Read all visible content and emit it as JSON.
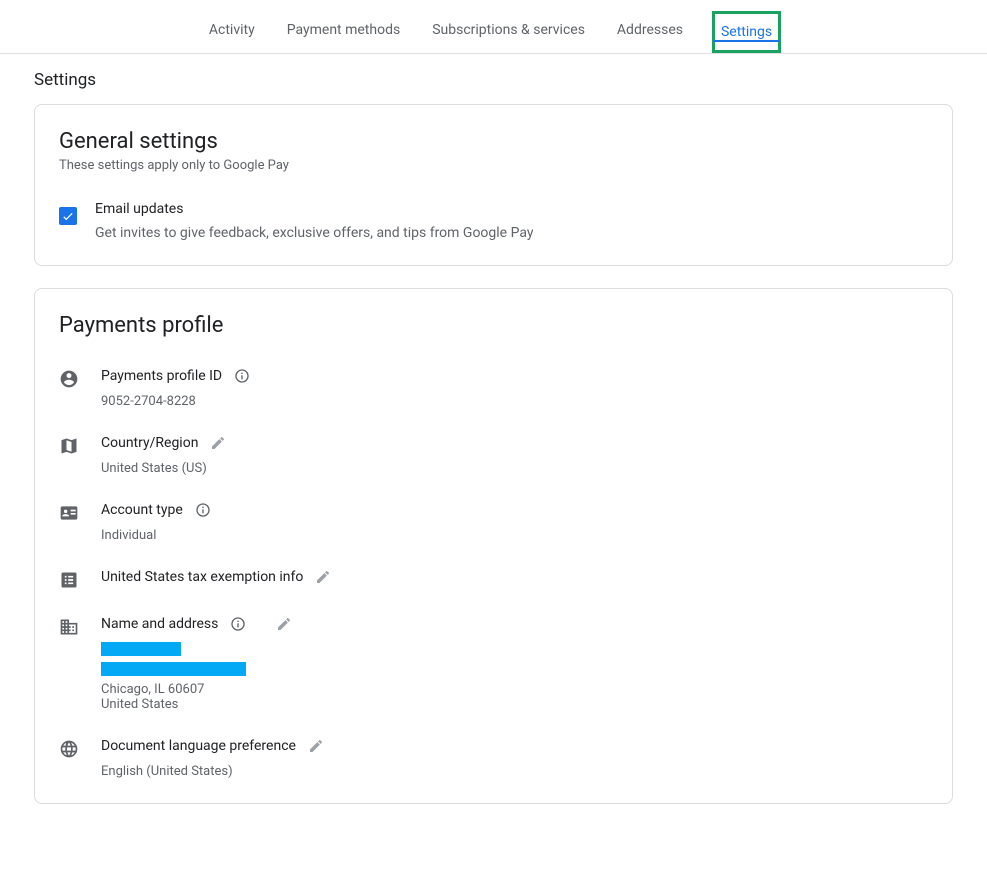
{
  "tabs": {
    "activity": "Activity",
    "payment_methods": "Payment methods",
    "subscriptions": "Subscriptions & services",
    "addresses": "Addresses",
    "settings": "Settings"
  },
  "page_title": "Settings",
  "general": {
    "heading": "General settings",
    "subheading": "These settings apply only to Google Pay",
    "email_updates_label": "Email updates",
    "email_updates_desc": "Get invites to give feedback, exclusive offers, and tips from Google Pay",
    "email_updates_checked": true
  },
  "profile": {
    "heading": "Payments profile",
    "profile_id_label": "Payments profile ID",
    "profile_id_value": "9052-2704-8228",
    "country_label": "Country/Region",
    "country_value": "United States (US)",
    "account_type_label": "Account type",
    "account_type_value": "Individual",
    "tax_label": "United States tax exemption info",
    "name_address_label": "Name and address",
    "address_city": "Chicago, IL 60607",
    "address_country": "United States",
    "doc_lang_label": "Document language preference",
    "doc_lang_value": "English (United States)"
  }
}
